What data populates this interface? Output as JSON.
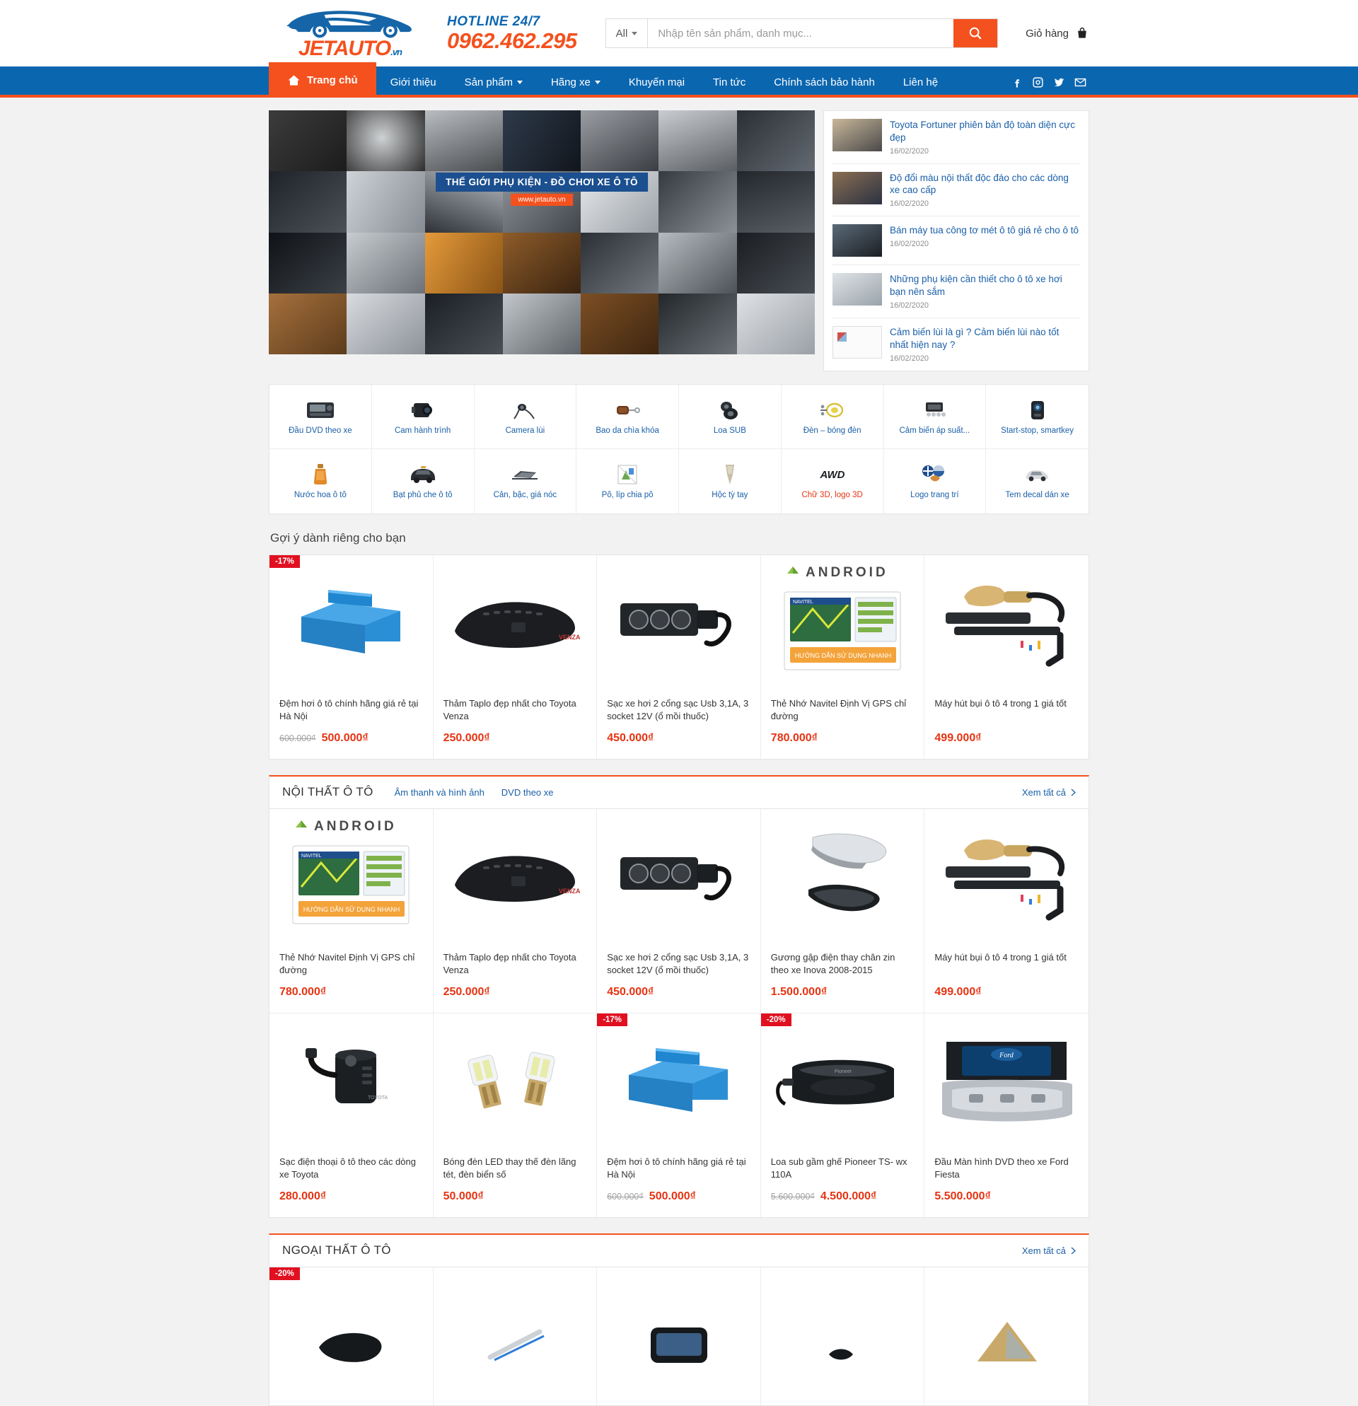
{
  "header": {
    "logo_text": "JETAUTO",
    "logo_suffix": ".vn",
    "hotline_label": "HOTLINE 24/7",
    "hotline_number": "0962.462.295",
    "search_scope": "All",
    "search_placeholder": "Nhập tên sản phẩm, danh mục...",
    "search_value": "",
    "search_icon": "search-icon",
    "cart_label": "Giỏ hàng",
    "cart_icon": "cart-icon"
  },
  "nav": {
    "home": {
      "label": "Trang chủ",
      "icon": "home-icon"
    },
    "items": [
      {
        "label": "Giới thiệu",
        "has_caret": false
      },
      {
        "label": "Sản phẩm",
        "has_caret": true
      },
      {
        "label": "Hãng xe",
        "has_caret": true
      },
      {
        "label": "Khuyến mại",
        "has_caret": false
      },
      {
        "label": "Tin tức",
        "has_caret": false
      },
      {
        "label": "Chính sách bảo hành",
        "has_caret": false
      },
      {
        "label": "Liên hệ",
        "has_caret": false
      }
    ],
    "social": [
      "facebook-icon",
      "instagram-icon",
      "twitter-icon",
      "email-icon"
    ]
  },
  "hero": {
    "caption_main": "THẾ GIỚI PHỤ KIỆN - ĐỒ CHƠI XE Ô TÔ",
    "caption_sub": "www.jetauto.vn"
  },
  "news": {
    "items": [
      {
        "title": "Toyota Fortuner phiên bản độ toàn diện cực đẹp",
        "date": "16/02/2020",
        "thumb": "ok"
      },
      {
        "title": "Độ đổi màu nội thất độc đáo cho các dòng xe cao cấp",
        "date": "16/02/2020",
        "thumb": "ok"
      },
      {
        "title": "Bán máy tua công tơ mét ô tô giá rẻ cho ô tô",
        "date": "16/02/2020",
        "thumb": "ok"
      },
      {
        "title": "Những phụ kiện cần thiết cho ô tô xe hơi bạn nên sắm",
        "date": "16/02/2020",
        "thumb": "ok"
      },
      {
        "title": "Cảm biến lùi là gì ? Cảm biến lùi nào tốt nhất hiện nay ?",
        "date": "16/02/2020",
        "thumb": "broken"
      }
    ]
  },
  "categories": [
    {
      "label": "Đầu DVD theo xe",
      "icon": "dvd-head-unit-icon",
      "red": false
    },
    {
      "label": "Cam hành trình",
      "icon": "dashcam-icon",
      "red": false
    },
    {
      "label": "Camera lùi",
      "icon": "reverse-camera-icon",
      "red": false
    },
    {
      "label": "Bao da chìa khóa",
      "icon": "key-case-icon",
      "red": false
    },
    {
      "label": "Loa SUB",
      "icon": "subwoofer-icon",
      "red": false
    },
    {
      "label": "Đèn – bóng đèn",
      "icon": "lamp-bulb-icon",
      "red": false
    },
    {
      "label": "Cảm biến áp suất...",
      "icon": "tire-pressure-sensor-icon",
      "red": false
    },
    {
      "label": "Start-stop, smartkey",
      "icon": "smartkey-icon",
      "red": false
    },
    {
      "label": "Nước hoa ô tô",
      "icon": "car-perfume-icon",
      "red": false
    },
    {
      "label": "Bạt phủ che ô tô",
      "icon": "car-cover-icon",
      "red": false
    },
    {
      "label": "Cản, bậc, giá nóc",
      "icon": "roof-rack-icon",
      "red": false
    },
    {
      "label": "Pô, líp chia pô",
      "icon": "exhaust-tip-icon",
      "red": false
    },
    {
      "label": "Hộc tỳ tay",
      "icon": "armrest-box-icon",
      "red": false
    },
    {
      "label": "Chữ 3D, logo 3D",
      "icon": "awd-badge-icon",
      "red": true
    },
    {
      "label": "Logo trang trí",
      "icon": "decor-logo-icon",
      "red": false
    },
    {
      "label": "Tem decal dán xe",
      "icon": "decal-sticker-icon",
      "red": false
    }
  ],
  "suggest": {
    "title": "Gợi ý dành riêng cho bạn",
    "products": [
      {
        "name": "Đệm hơi ô tô chính hãng giá rẻ tại Hà Nội",
        "price": "500.000₫",
        "old_price": "600.000₫",
        "badge": "-17%",
        "art": "air-mattress"
      },
      {
        "name": "Thảm Taplo đẹp nhất cho Toyota Venza",
        "price": "250.000₫",
        "old_price": "",
        "badge": "",
        "art": "dash-mat"
      },
      {
        "name": "Sạc xe hơi 2 cổng sạc Usb 3,1A, 3 socket 12V (ổ mồi thuốc)",
        "price": "450.000₫",
        "old_price": "",
        "badge": "",
        "art": "car-charger"
      },
      {
        "name": "Thẻ Nhớ Navitel Định Vị GPS chỉ đường",
        "price": "780.000₫",
        "old_price": "",
        "badge": "",
        "art": "navitel-box"
      },
      {
        "name": "Máy hút bụi ô tô 4 trong 1 giá tốt",
        "price": "499.000₫",
        "old_price": "",
        "badge": "",
        "art": "vacuum"
      }
    ]
  },
  "section_interior": {
    "title": "NỘI THẤT Ô TÔ",
    "links": [
      "Âm thanh và hình ảnh",
      "DVD theo xe"
    ],
    "view_all": "Xem tất cả",
    "rows": [
      [
        {
          "name": "Thẻ Nhớ Navitel Định Vị GPS chỉ đường",
          "price": "780.000₫",
          "old_price": "",
          "badge": "",
          "art": "navitel-box"
        },
        {
          "name": "Thảm Taplo đẹp nhất cho Toyota Venza",
          "price": "250.000₫",
          "old_price": "",
          "badge": "",
          "art": "dash-mat"
        },
        {
          "name": "Sạc xe hơi 2 cổng sạc Usb 3,1A, 3 socket 12V (ổ mồi thuốc)",
          "price": "450.000₫",
          "old_price": "",
          "badge": "",
          "art": "car-charger"
        },
        {
          "name": "Gương gập điện thay chân zin theo xe Inova 2008-2015",
          "price": "1.500.000₫",
          "old_price": "",
          "badge": "",
          "art": "mirror"
        },
        {
          "name": "Máy hút bụi ô tô 4 trong 1 giá tốt",
          "price": "499.000₫",
          "old_price": "",
          "badge": "",
          "art": "vacuum"
        }
      ],
      [
        {
          "name": "Sạc điện thoại ô tô theo các dòng xe Toyota",
          "price": "280.000₫",
          "old_price": "",
          "badge": "",
          "art": "phone-charger"
        },
        {
          "name": "Bóng đèn LED thay thế đèn lãng tét, đèn biển số",
          "price": "50.000₫",
          "old_price": "",
          "badge": "",
          "art": "led-bulbs"
        },
        {
          "name": "Đệm hơi ô tô chính hãng giá rẻ tại Hà Nội",
          "price": "500.000₫",
          "old_price": "600.000₫",
          "badge": "-17%",
          "art": "air-mattress"
        },
        {
          "name": "Loa sub gầm ghế Pioneer TS- wx 110A",
          "price": "4.500.000₫",
          "old_price": "5.600.000₫",
          "badge": "-20%",
          "art": "under-seat-sub"
        },
        {
          "name": "Đầu Màn hình DVD theo xe Ford Fiesta",
          "price": "5.500.000₫",
          "old_price": "",
          "badge": "",
          "art": "ford-dvd"
        }
      ]
    ]
  },
  "section_exterior": {
    "title": "NGOẠI THẤT Ô TÔ",
    "view_all": "Xem tất cả",
    "rows": [
      [
        {
          "name": "",
          "price": "",
          "old_price": "",
          "badge": "-20%",
          "art": "black-part"
        },
        {
          "name": "",
          "price": "",
          "old_price": "",
          "badge": "",
          "art": "wiper"
        },
        {
          "name": "",
          "price": "",
          "old_price": "",
          "badge": "",
          "art": "gps-unit"
        },
        {
          "name": "",
          "price": "",
          "old_price": "",
          "badge": "",
          "art": "small-part"
        },
        {
          "name": "",
          "price": "",
          "old_price": "",
          "badge": "",
          "art": "gold-plate"
        }
      ]
    ]
  },
  "colors": {
    "brand_blue": "#0b66b0",
    "brand_orange": "#f4511e",
    "price_red": "#e63312",
    "badge_red": "#e01020",
    "link_blue": "#1a5fa8"
  }
}
